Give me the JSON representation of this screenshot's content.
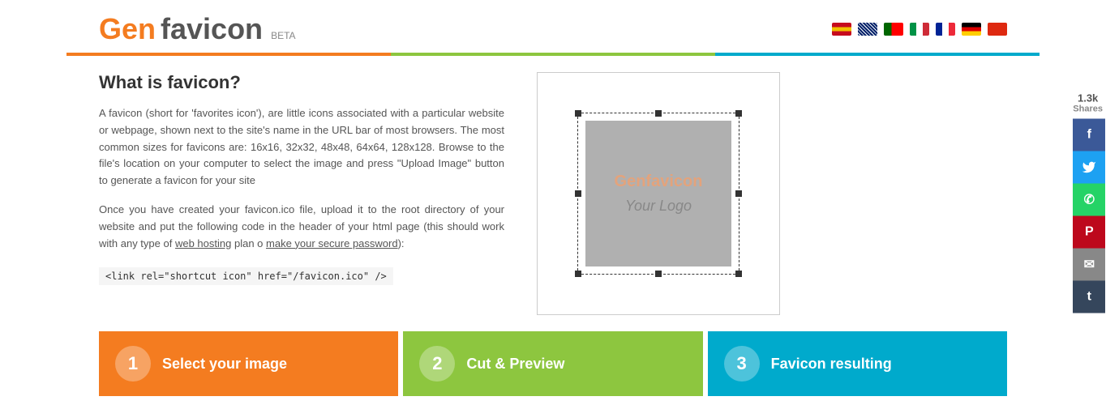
{
  "header": {
    "logo_gen": "Gen",
    "logo_favicon": "favicon",
    "logo_beta": "BETA"
  },
  "languages": [
    {
      "name": "Spanish",
      "color": "#c60b1e"
    },
    {
      "name": "English",
      "color": "#012169"
    },
    {
      "name": "Portuguese",
      "color": "#006600"
    },
    {
      "name": "Italian",
      "color": "#009246"
    },
    {
      "name": "French",
      "color": "#002395"
    },
    {
      "name": "German",
      "color": "#000000"
    },
    {
      "name": "Chinese",
      "color": "#de2910"
    }
  ],
  "main": {
    "title": "What is favicon?",
    "paragraph1": "A favicon (short for 'favorites icon'), are little icons associated with a particular website or webpage, shown next to the site's name in the URL bar of most browsers. The most common sizes for favicons are: 16x16, 32x32, 48x48, 64x64, 128x128. Browse to the file's location on your computer to select the image and press \"Upload Image\" button to generate a favicon for your site",
    "paragraph2": "Once you have created your favicon.ico file, upload it to the root directory of your website and put the following code in the header of your html page (this should work with any type of",
    "link1": "web hosting",
    "link_middle": "plan o",
    "link2": "make your secure password",
    "link_end": "):",
    "code": "<link rel=\"shortcut icon\" href=\"/favicon.ico\" />"
  },
  "preview": {
    "gen_text": "Genfavicon",
    "your_logo": "Your Logo"
  },
  "steps": [
    {
      "number": "1",
      "label": "Select your image",
      "color": "orange"
    },
    {
      "number": "2",
      "label": "Cut & Preview",
      "color": "green"
    },
    {
      "number": "3",
      "label": "Favicon resulting",
      "color": "cyan"
    }
  ],
  "social": {
    "count": "1.3k",
    "shares_label": "Shares",
    "buttons": [
      {
        "name": "facebook",
        "symbol": "f"
      },
      {
        "name": "twitter",
        "symbol": "🐦"
      },
      {
        "name": "whatsapp",
        "symbol": "✆"
      },
      {
        "name": "pinterest",
        "symbol": "P"
      },
      {
        "name": "email",
        "symbol": "✉"
      },
      {
        "name": "tumblr",
        "symbol": "t"
      }
    ]
  }
}
